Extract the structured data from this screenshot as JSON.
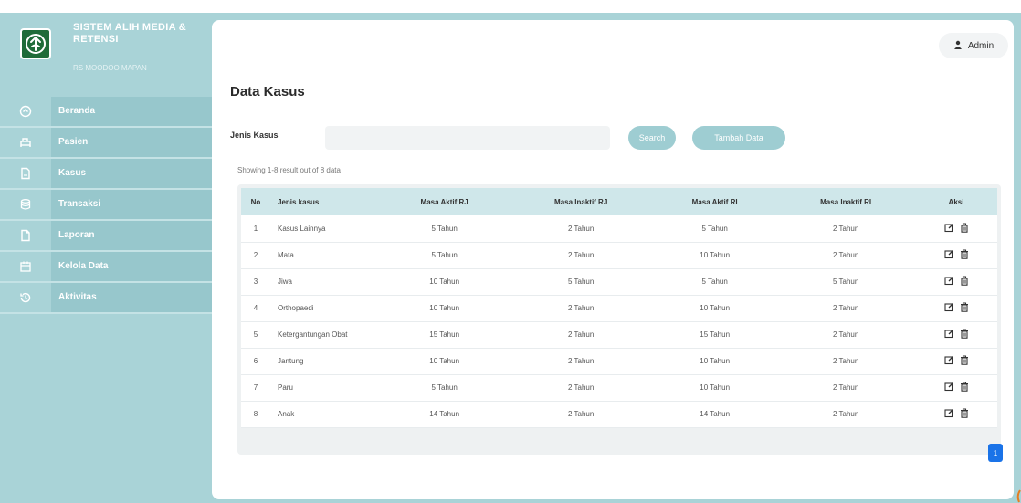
{
  "brand": {
    "title": "SISTEM ALIH MEDIA & RETENSI",
    "subtitle": "RS MOODOO MAPAN"
  },
  "sidebar": {
    "items": [
      {
        "label": "Beranda",
        "icon": "home-icon"
      },
      {
        "label": "Pasien",
        "icon": "bed-icon"
      },
      {
        "label": "Kasus",
        "icon": "document-icon"
      },
      {
        "label": "Transaksi",
        "icon": "database-icon"
      },
      {
        "label": "Laporan",
        "icon": "file-icon"
      },
      {
        "label": "Kelola Data",
        "icon": "calendar-icon"
      },
      {
        "label": "Aktivitas",
        "icon": "history-icon"
      }
    ]
  },
  "header": {
    "user_label": "Admin"
  },
  "page": {
    "title": "Data Kasus",
    "filter_label": "Jenis Kasus",
    "filter_value": "",
    "search_label": "Search",
    "add_label": "Tambah Data",
    "showing": "Showing 1-8 result out of 8 data"
  },
  "table": {
    "headers": [
      "No",
      "Jenis kasus",
      "Masa Aktif RJ",
      "Masa Inaktif RJ",
      "Masa Aktif RI",
      "Masa Inaktif RI",
      "Aksi"
    ],
    "rows": [
      [
        "1",
        "Kasus Lainnya",
        "5 Tahun",
        "2 Tahun",
        "5 Tahun",
        "2 Tahun"
      ],
      [
        "2",
        "Mata",
        "5 Tahun",
        "2 Tahun",
        "10 Tahun",
        "2 Tahun"
      ],
      [
        "3",
        "Jiwa",
        "10 Tahun",
        "5 Tahun",
        "5 Tahun",
        "5 Tahun"
      ],
      [
        "4",
        "Orthopaedi",
        "10 Tahun",
        "2 Tahun",
        "10 Tahun",
        "2 Tahun"
      ],
      [
        "5",
        "Ketergantungan Obat",
        "15 Tahun",
        "2 Tahun",
        "15 Tahun",
        "2 Tahun"
      ],
      [
        "6",
        "Jantung",
        "10 Tahun",
        "2 Tahun",
        "10 Tahun",
        "2 Tahun"
      ],
      [
        "7",
        "Paru",
        "5 Tahun",
        "2 Tahun",
        "10 Tahun",
        "2 Tahun"
      ],
      [
        "8",
        "Anak",
        "14 Tahun",
        "2 Tahun",
        "14 Tahun",
        "2 Tahun"
      ]
    ]
  },
  "pagination": {
    "current": "1"
  },
  "colors": {
    "sidebar_bg": "#a9d3d7",
    "menu_label_bg": "#97c7cc",
    "button_bg": "#9ecdd2",
    "header_row_bg": "#cfe7ea",
    "page_active": "#1a73e8",
    "logo_green": "#1f6b39"
  }
}
